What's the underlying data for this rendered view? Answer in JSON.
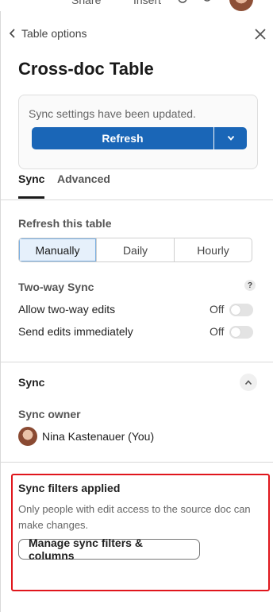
{
  "topbar": {
    "share_label": "Share",
    "insert_label": "Insert"
  },
  "panel": {
    "back_label": "Table options",
    "title": "Cross-doc Table",
    "notice": {
      "message": "Sync settings have been updated.",
      "refresh_label": "Refresh"
    },
    "tabs": [
      {
        "label": "Sync",
        "active": true
      },
      {
        "label": "Advanced",
        "active": false
      }
    ],
    "refresh_table": {
      "label": "Refresh this table",
      "options": [
        {
          "label": "Manually",
          "selected": true
        },
        {
          "label": "Daily",
          "selected": false
        },
        {
          "label": "Hourly",
          "selected": false
        }
      ]
    },
    "two_way": {
      "label": "Two-way Sync",
      "help_glyph": "?",
      "rows": [
        {
          "label": "Allow two-way edits",
          "state": "Off"
        },
        {
          "label": "Send edits immediately",
          "state": "Off"
        }
      ]
    },
    "sync_section": {
      "title": "Sync",
      "owner_label": "Sync owner",
      "owner_name": "Nina Kastenauer (You)"
    },
    "filters": {
      "title": "Sync filters applied",
      "description": "Only people with edit access to the source doc can make changes.",
      "button_label": "Manage sync filters & columns"
    }
  },
  "colors": {
    "primary_button": "#1a66b7",
    "highlight_border": "#e0161c",
    "selected_segment_bg": "#e6f0fb"
  }
}
